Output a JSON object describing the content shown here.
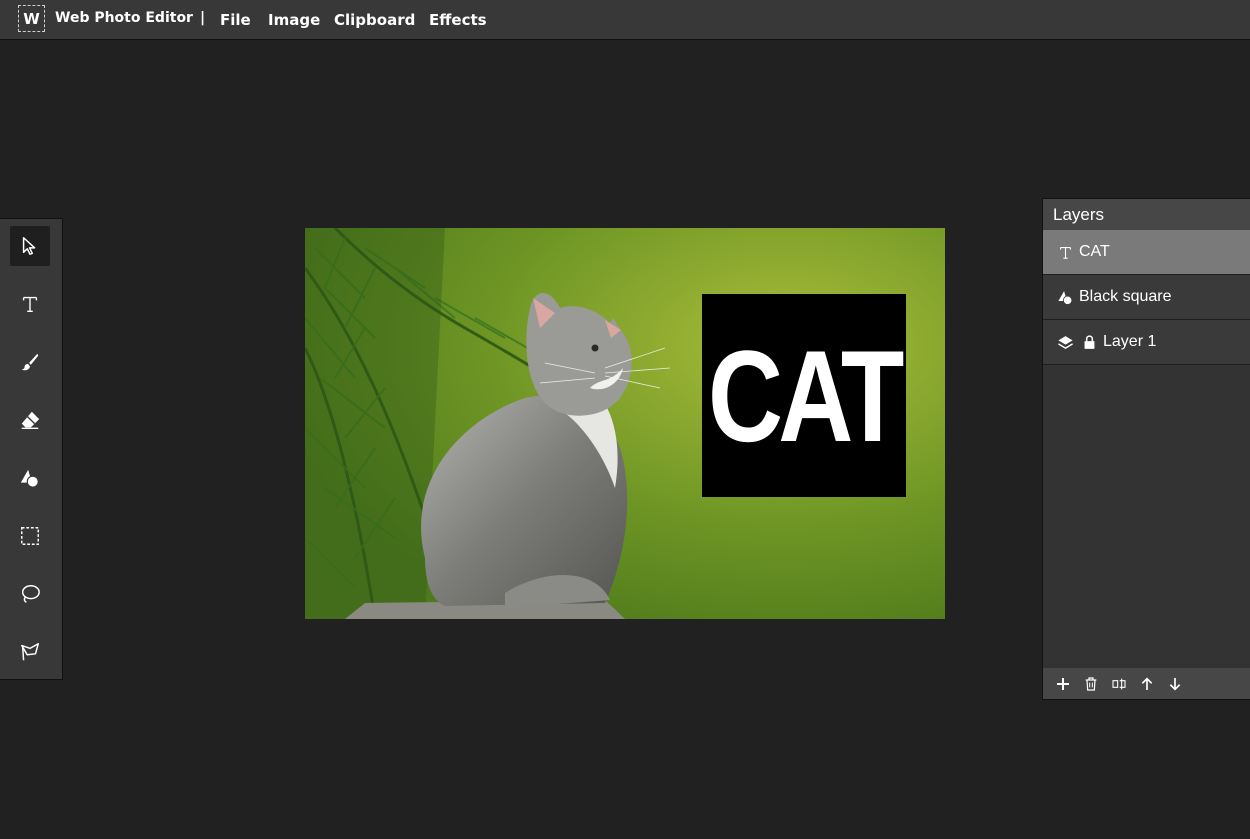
{
  "app": {
    "logo_letter": "W",
    "title": "Web Photo Editor",
    "separator": "|"
  },
  "menu": [
    {
      "label": "File"
    },
    {
      "label": "Image"
    },
    {
      "label": "Clipboard"
    },
    {
      "label": "Effects"
    }
  ],
  "tools": [
    {
      "name": "select-tool",
      "icon": "pointer-arrow-icon",
      "active": true
    },
    {
      "name": "text-tool",
      "icon": "text-t-icon",
      "active": false
    },
    {
      "name": "brush-tool",
      "icon": "paintbrush-icon",
      "active": false
    },
    {
      "name": "eraser-tool",
      "icon": "eraser-icon",
      "active": false
    },
    {
      "name": "shape-tool",
      "icon": "shapes-icon",
      "active": false
    },
    {
      "name": "rect-select-tool",
      "icon": "dashed-rectangle-icon",
      "active": false
    },
    {
      "name": "lasso-tool",
      "icon": "lasso-icon",
      "active": false
    },
    {
      "name": "polygon-lasso-tool",
      "icon": "polygon-lasso-icon",
      "active": false
    }
  ],
  "canvas": {
    "overlay_text": "CAT"
  },
  "layers": {
    "title": "Layers",
    "items": [
      {
        "label": "CAT",
        "icon": "text-t-icon",
        "selected": true,
        "locked": false
      },
      {
        "label": "Black square",
        "icon": "shapes-icon",
        "selected": false,
        "locked": false
      },
      {
        "label": "Layer 1",
        "icon": "layers-stack-icon",
        "selected": false,
        "locked": true
      }
    ],
    "footer_buttons": [
      {
        "name": "add-layer-button",
        "icon": "plus-icon"
      },
      {
        "name": "delete-layer-button",
        "icon": "trash-icon"
      },
      {
        "name": "rename-layer-button",
        "icon": "rename-icon"
      },
      {
        "name": "move-layer-up-button",
        "icon": "arrow-up-icon"
      },
      {
        "name": "move-layer-down-button",
        "icon": "arrow-down-icon"
      }
    ]
  },
  "colors": {
    "background": "#212121",
    "bar": "#383838",
    "selected_layer": "#7a7a7a"
  }
}
